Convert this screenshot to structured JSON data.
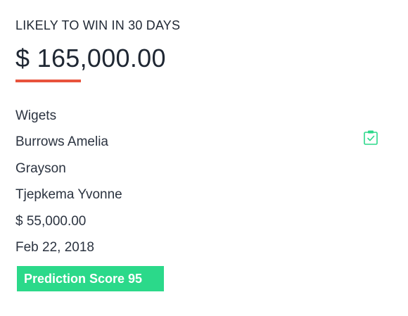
{
  "header": {
    "title": "LIKELY TO WIN IN 30 DAYS"
  },
  "summary": {
    "amount": "$ 165,000.00",
    "accent_color": "#e8533c"
  },
  "details": {
    "company": "Wigets",
    "contact": "Burrows Amelia",
    "account": "Grayson",
    "owner": "Tjepkema Yvonne",
    "deal_value": "$ 55,000.00",
    "date": "Feb 22, 2018"
  },
  "icons": {
    "contact_action": "clipboard-check-icon"
  },
  "prediction": {
    "label": "Prediction Score 95",
    "badge_color": "#2bd98a"
  }
}
